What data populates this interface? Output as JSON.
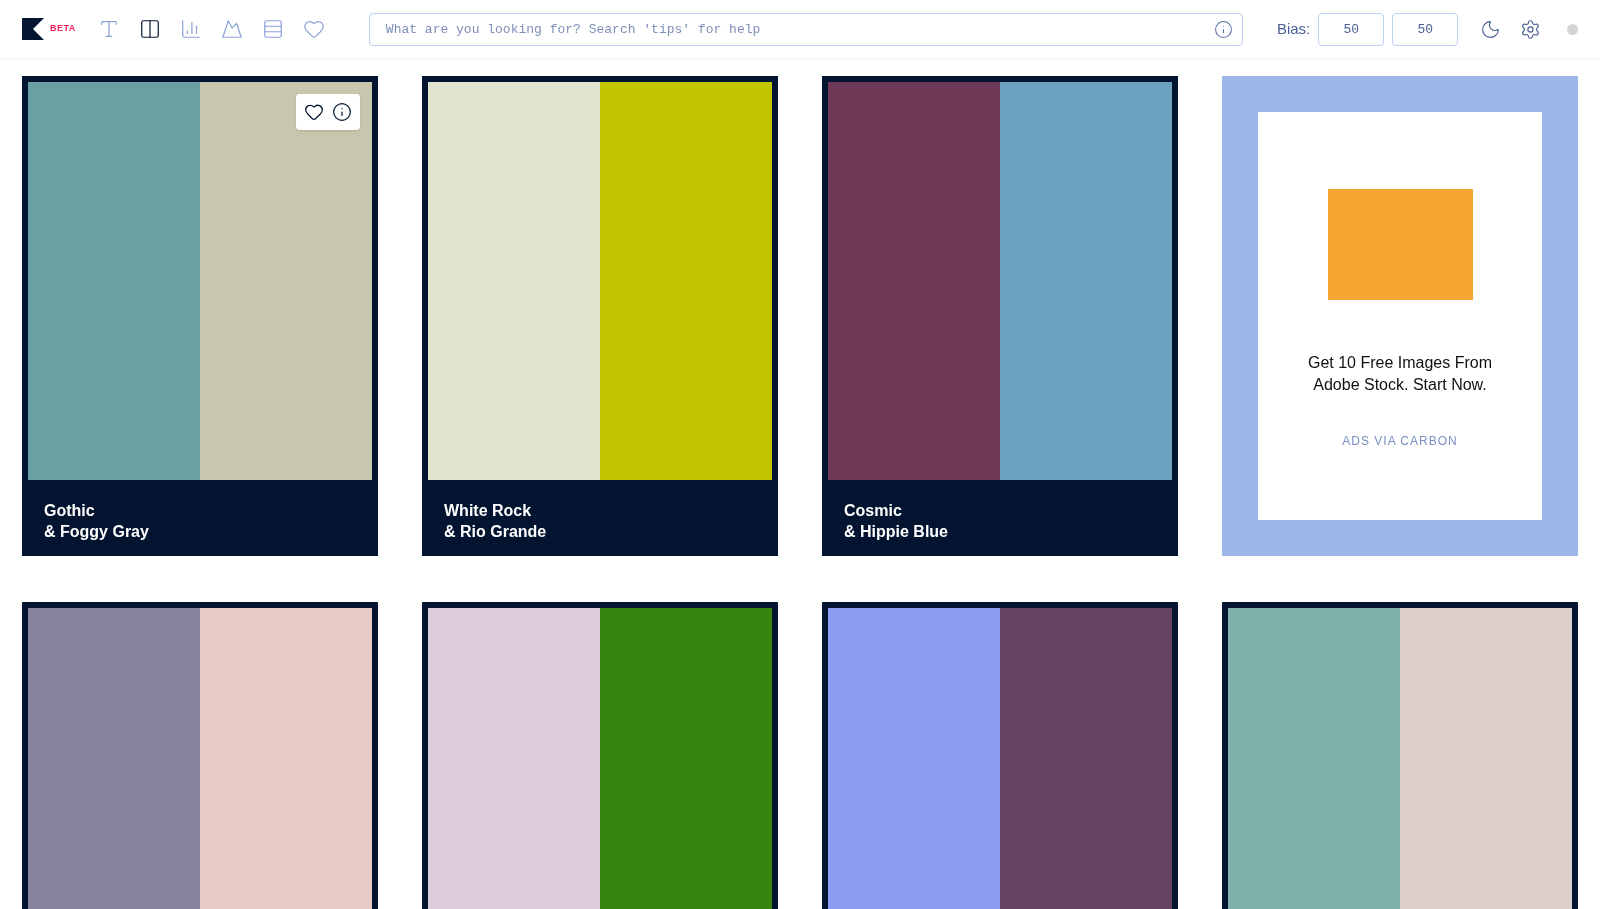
{
  "header": {
    "logo_badge": "BETA",
    "nav": [
      {
        "kind": "font",
        "selected": false
      },
      {
        "kind": "columns",
        "selected": true
      },
      {
        "kind": "chart",
        "selected": false
      },
      {
        "kind": "image",
        "selected": false
      },
      {
        "kind": "rows",
        "selected": false
      },
      {
        "kind": "heart",
        "selected": false
      }
    ],
    "search": {
      "placeholder": "What are you looking for? Search 'tips' for help"
    },
    "bias": {
      "label": "Bias:",
      "values": [
        "50",
        "50"
      ]
    }
  },
  "cards": [
    {
      "kind": "palette",
      "swatches": [
        {
          "color": "#6a9fa3"
        },
        {
          "color": "#c9c6b0"
        }
      ],
      "name": "Gothic",
      "second_name": "& Foggy Gray",
      "hovered": true
    },
    {
      "kind": "palette",
      "swatches": [
        {
          "color": "#e2e5d0"
        },
        {
          "color": "#c2c600"
        }
      ],
      "name": "White Rock",
      "second_name": "& Rio Grande",
      "hovered": false
    },
    {
      "kind": "palette",
      "swatches": [
        {
          "color": "#6e3957"
        },
        {
          "color": "#6aa2bf"
        }
      ],
      "name": "Cosmic",
      "second_name": "& Hippie Blue",
      "hovered": false
    },
    {
      "kind": "ad",
      "text": "Get 10 Free Images From Adobe Stock. Start Now.",
      "via": "ADS VIA CARBON"
    },
    {
      "kind": "palette",
      "swatches": [
        {
          "color": "#85839d"
        },
        {
          "color": "#e8cbc6"
        }
      ],
      "hovered": false
    },
    {
      "kind": "palette",
      "swatches": [
        {
          "color": "#dbcbdb"
        },
        {
          "color": "#36850f"
        }
      ],
      "hovered": false
    },
    {
      "kind": "palette",
      "swatches": [
        {
          "color": "#899cf1"
        },
        {
          "color": "#644360"
        }
      ],
      "hovered": false
    },
    {
      "kind": "palette",
      "swatches": [
        {
          "color": "#7fb2ac"
        },
        {
          "color": "#dccfcc"
        }
      ],
      "hovered": false
    }
  ]
}
